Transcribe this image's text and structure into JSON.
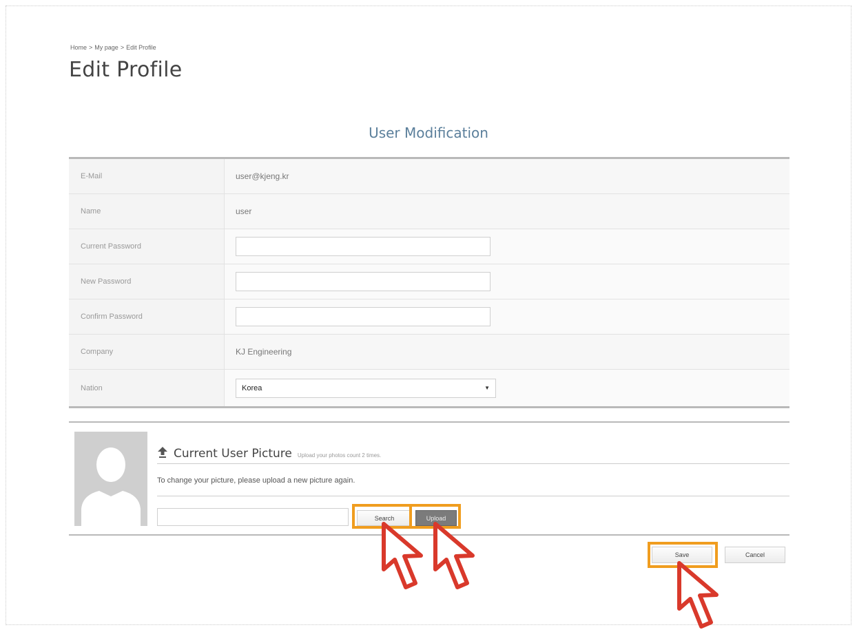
{
  "breadcrumb": {
    "home": "Home",
    "sep1": ">",
    "my_page": "My page",
    "sep2": ">",
    "current": "Edit Profile"
  },
  "page_title": "Edit Profile",
  "section_title": "User Modification",
  "fields": {
    "email": {
      "label": "E-Mail",
      "value": "user@kjeng.kr"
    },
    "name": {
      "label": "Name",
      "value": "user"
    },
    "current_password": {
      "label": "Current Password",
      "value": ""
    },
    "new_password": {
      "label": "New Password",
      "value": ""
    },
    "confirm_password": {
      "label": "Confirm Password",
      "value": ""
    },
    "company": {
      "label": "Company",
      "value": "KJ Engineering"
    },
    "nation": {
      "label": "Nation",
      "selected": "Korea"
    }
  },
  "picture": {
    "title": "Current User Picture",
    "note": "Upload your photos count 2 times.",
    "instructions": "To change your picture, please upload a new picture again.",
    "file_value": "",
    "search_label": "Search",
    "upload_label": "Upload"
  },
  "actions": {
    "save_label": "Save",
    "cancel_label": "Cancel"
  },
  "colors": {
    "highlight": "#f09d1f",
    "cursor_red": "#d9392b",
    "title_blue": "#5b7f9b"
  },
  "icons": {
    "upload": "upload-arrow-icon",
    "avatar": "default-avatar-icon",
    "cursor": "mouse-pointer-icon"
  }
}
